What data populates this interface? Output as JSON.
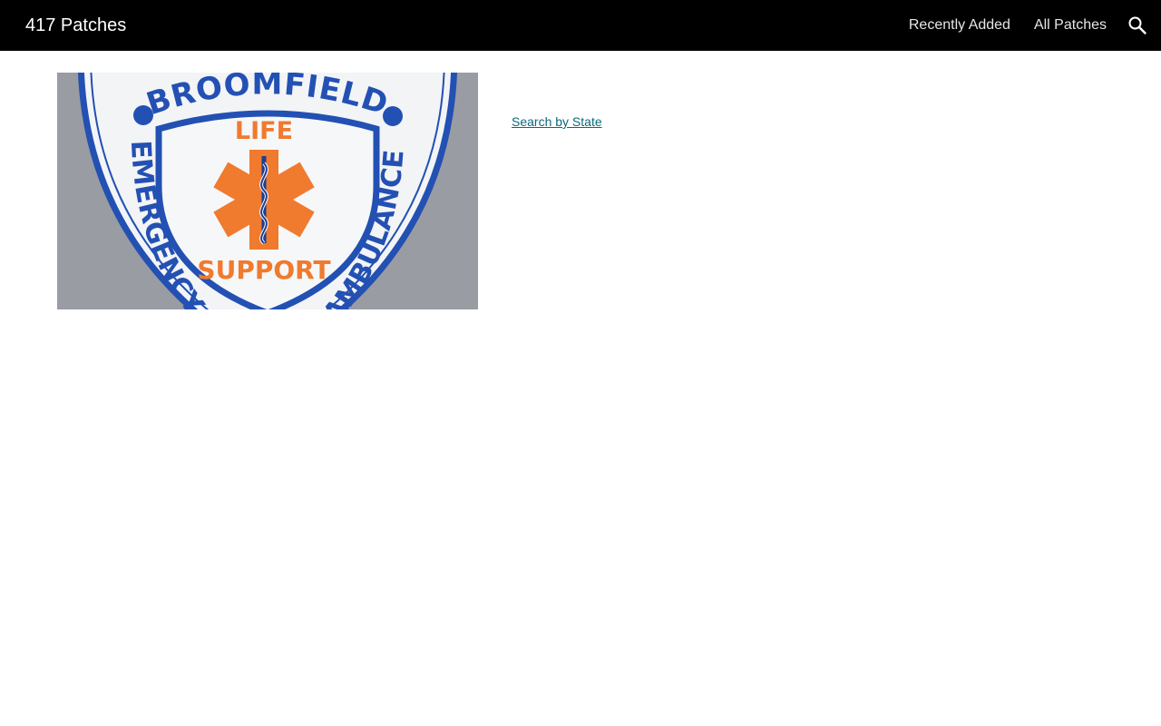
{
  "header": {
    "site_title": "417 Patches",
    "nav": [
      {
        "label": "Recently Added"
      },
      {
        "label": "All Patches"
      }
    ],
    "search_icon": "search-icon",
    "background": "#000000"
  },
  "main": {
    "image": {
      "top_text": "BROOMFIELD",
      "center_top": "LIFE",
      "center_bottom": "SUPPORT",
      "left_text": "EMERGENCY",
      "right_text": "AMBULANCE",
      "colors": {
        "blue": "#2350b3",
        "orange": "#f07a2e",
        "fabric": "#f3f4f6",
        "background": "#9a9ca3"
      }
    },
    "state_link": "Search by State",
    "link_color": "#0b6a7d"
  }
}
